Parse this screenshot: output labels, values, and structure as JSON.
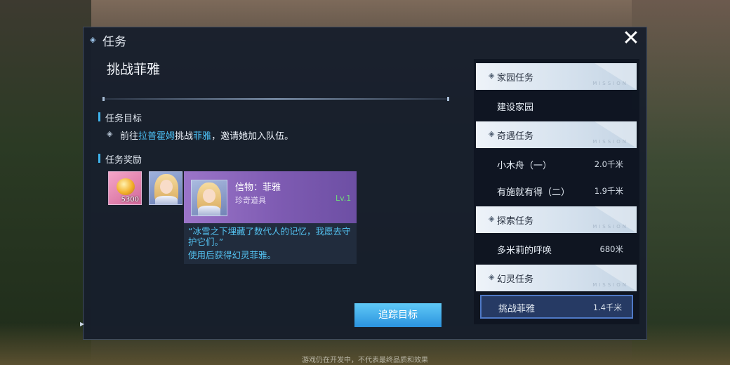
{
  "header": {
    "title": "任务",
    "close_label": "✕"
  },
  "quest": {
    "name": "挑战菲雅",
    "objective_heading": "任务目标",
    "objective": {
      "prefix": "前往",
      "place": "拉普霍姆",
      "mid": "挑战",
      "target": "菲雅",
      "suffix": "，邀请她加入队伍。"
    },
    "reward_heading": "任务奖励",
    "rewards": [
      {
        "icon": "crystal-gem-icon",
        "count": "5300"
      },
      {
        "icon": "character-portrait-icon"
      }
    ],
    "track_button": "追踪目标"
  },
  "tooltip": {
    "name": "信物：菲雅",
    "type": "珍奇道具",
    "level": "Lv.1",
    "quote": "“冰雪之下埋藏了数代人的记忆，我愿去守护它们。”",
    "desc": "使用后获得幻灵菲雅。"
  },
  "quest_list": {
    "mission_watermark": "MISSION",
    "categories": [
      {
        "label": "家园任务",
        "quests": [
          {
            "name": "建设家园",
            "distance": ""
          }
        ]
      },
      {
        "label": "奇遇任务",
        "quests": [
          {
            "name": "小木舟（一）",
            "distance": "2.0千米"
          },
          {
            "name": "有施就有得（二）",
            "distance": "1.9千米"
          }
        ]
      },
      {
        "label": "探索任务",
        "quests": [
          {
            "name": "多米莉的呼唤",
            "distance": "680米"
          }
        ]
      },
      {
        "label": "幻灵任务",
        "quests": [
          {
            "name": "挑战菲雅",
            "distance": "1.4千米",
            "active": true
          }
        ]
      }
    ]
  },
  "footer": "游戏仍在开发中，不代表最终品质和效果",
  "colors": {
    "accent": "#3fb3ec",
    "highlight": "#4cc0f5",
    "tooltip_purple": "#8a66bf",
    "level_green": "#6fdc7a"
  }
}
